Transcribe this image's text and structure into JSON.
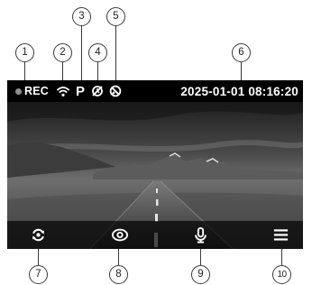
{
  "callouts": [
    "1",
    "2",
    "3",
    "4",
    "5",
    "6",
    "7",
    "8",
    "9",
    "10"
  ],
  "status_bar": {
    "rec_label": "REC",
    "rec_dot_color": "#8e8e8e",
    "wifi_icon": "wifi-icon",
    "mode_letter": "P",
    "gps_icon": "gps-off-icon",
    "mute_icon": "mic-off-icon",
    "datetime": "2025-01-01 08:16:20"
  },
  "toolbar": {
    "buttons": [
      {
        "icon": "switch-camera-icon",
        "callout": "7"
      },
      {
        "icon": "eye-icon",
        "callout": "8"
      },
      {
        "icon": "microphone-icon",
        "callout": "9"
      },
      {
        "icon": "menu-icon",
        "callout": "10"
      }
    ]
  },
  "colors": {
    "callout_stroke": "#3a3a3a",
    "overlay_text": "#ffffff",
    "toolbar_bg": "rgba(0,0,0,0.68)"
  }
}
